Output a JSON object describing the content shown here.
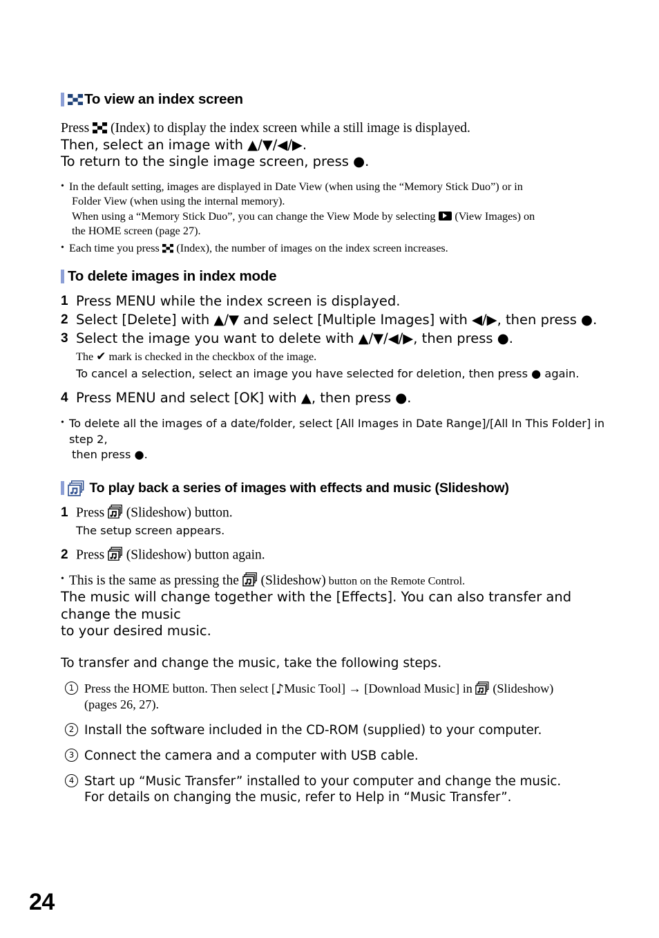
{
  "page": {
    "number": "24"
  },
  "colors": {
    "heading_bar": "#8c9fd6",
    "slideshow_icon_blue": "#2a4b8d",
    "index_icon_blue": "#1d4076",
    "text": "#000000",
    "background": "#ffffff"
  },
  "sections": {
    "index_screen": {
      "heading": "To view an index screen",
      "heading_icon": "index-checkerboard-icon",
      "body_lines": [
        {
          "pre": "Press ",
          "icon": "index-checkerboard-icon",
          "post": " (Index) to display the index screen while a still image is displayed."
        },
        {
          "text": "Then, select an image with ▲/▼/◀/▶."
        },
        {
          "text": "To return to the single image screen, press ●."
        }
      ],
      "bullets": [
        {
          "lines": [
            "In the default setting, images are displayed in Date View (when using the “Memory Stick Duo”) or in",
            "Folder View (when using the internal memory).",
            "When using a “Memory Stick Duo”, you can change the View Mode by selecting",
            "(View Images) on",
            "the HOME screen (page 27)."
          ],
          "inline_icon": "play-view-images-icon"
        },
        {
          "pre": "Each time you press ",
          "icon": "index-checkerboard-icon",
          "post": " (Index), the number of images on the index screen increases."
        }
      ]
    },
    "delete_images": {
      "heading": "To delete images in index mode",
      "steps": [
        {
          "num": "1",
          "text": "Press MENU while the index screen is displayed."
        },
        {
          "num": "2",
          "text": "Select [Delete] with ▲/▼ and select [Multiple Images] with ◀/▶, then press ●."
        },
        {
          "num": "3",
          "text": "Select the image you want to delete with ▲/▼/◀/▶, then press ●."
        },
        {
          "num": "4",
          "text": "Press MENU and select [OK] with ▲, then press ●."
        }
      ],
      "step3_subs": [
        {
          "pre": "The ",
          "icon": "checkmark-icon",
          "post": " mark is checked in the checkbox of the image."
        },
        {
          "text": "To cancel a selection, select an image you have selected for deletion, then press ● again."
        }
      ],
      "bullet": {
        "line1": "To delete all the images of a date/folder, select [All Images in Date Range]/[All In This Folder] in step 2,",
        "line2": "then press ●."
      }
    },
    "slideshow": {
      "heading": "To play back a series of images with effects and music (Slideshow)",
      "heading_icon": "slideshow-icon",
      "steps": [
        {
          "num": "1",
          "pre": "Press ",
          "icon": "slideshow-icon",
          "post": " (Slideshow) button."
        },
        {
          "num": "2",
          "pre": "Press ",
          "icon": "slideshow-icon",
          "post": " (Slideshow) button again."
        }
      ],
      "step1_sub": "The setup screen appears.",
      "remote_bullet": {
        "pre": "This is the same as pressing the ",
        "icon": "slideshow-icon",
        "mid": " (Slideshow)",
        "post": " button on the Remote Control."
      },
      "paragraph_lines": [
        "The music will change together with the [Effects]. You can also transfer and change the music",
        "to your desired music."
      ],
      "transfer_intro": "To transfer and change the music, take the following steps.",
      "transfer_steps": [
        {
          "num": "①",
          "seg1": "Press the HOME button. Then select [",
          "icon1": "music-note-icon",
          "seg2": "Music Tool] → [Download Music] in ",
          "icon2": "slideshow-icon",
          "seg3": " (Slideshow)",
          "line2": "(pages 26, 27)."
        },
        {
          "num": "②",
          "text": "Install the software included in the CD-ROM (supplied) to your computer."
        },
        {
          "num": "③",
          "text": "Connect the camera and a computer with USB cable."
        },
        {
          "num": "④",
          "text": "Start up “Music Transfer” installed to your computer and change the music.",
          "line2": "For details on changing the music, refer to Help in “Music Transfer”."
        }
      ]
    }
  }
}
